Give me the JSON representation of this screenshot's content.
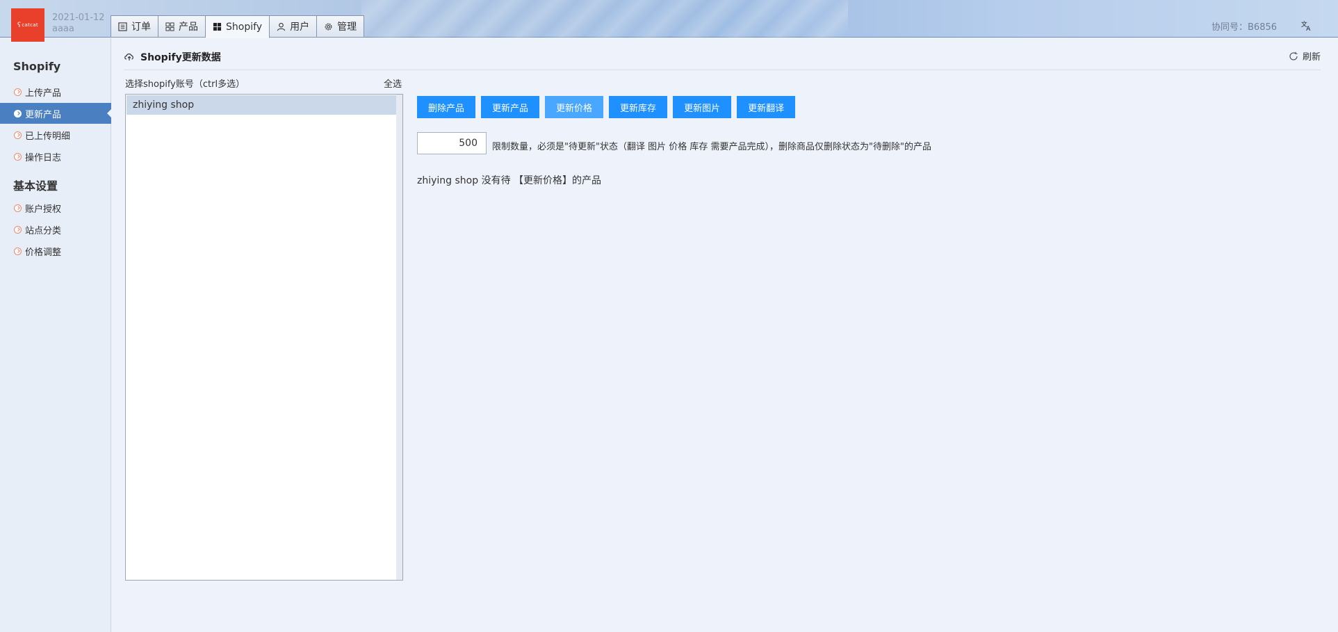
{
  "header": {
    "logo_text": "catcat",
    "date": "2021-01-12",
    "user": "aaaa",
    "contract": "协同号：B6856",
    "tabs": [
      {
        "label": "订单",
        "icon": "list-icon"
      },
      {
        "label": "产品",
        "icon": "grid-icon"
      },
      {
        "label": "Shopify",
        "icon": "windows-icon",
        "active": true
      },
      {
        "label": "用户",
        "icon": "user-icon"
      },
      {
        "label": "管理",
        "icon": "gear-icon"
      }
    ],
    "language_icon": "translate-icon"
  },
  "sidebar": {
    "section1_title": "Shopify",
    "section1_items": [
      "上传产品",
      "更新产品",
      "已上传明细",
      "操作日志"
    ],
    "active_item": "更新产品",
    "section2_title": "基本设置",
    "section2_items": [
      "账户授权",
      "站点分类",
      "价格调整"
    ]
  },
  "main": {
    "title": "Shopify更新数据",
    "refresh_label": "刷新",
    "account_label": "选择shopify账号（ctrl多选）",
    "select_all": "全选",
    "accounts": [
      "zhiying shop"
    ],
    "buttons": [
      "删除产品",
      "更新产品",
      "更新价格",
      "更新库存",
      "更新图片",
      "更新翻译"
    ],
    "limit_value": "500",
    "limit_note": "限制数量，必须是\"待更新\"状态（翻译 图片 价格 库存 需要产品完成），删除商品仅删除状态为\"待删除\"的产品",
    "status_message": "zhiying shop 没有待 【更新价格】的产品"
  },
  "colors": {
    "accent": "#1e90ff",
    "sidebar_active": "#4a7fc1",
    "logo": "#e8402b"
  }
}
